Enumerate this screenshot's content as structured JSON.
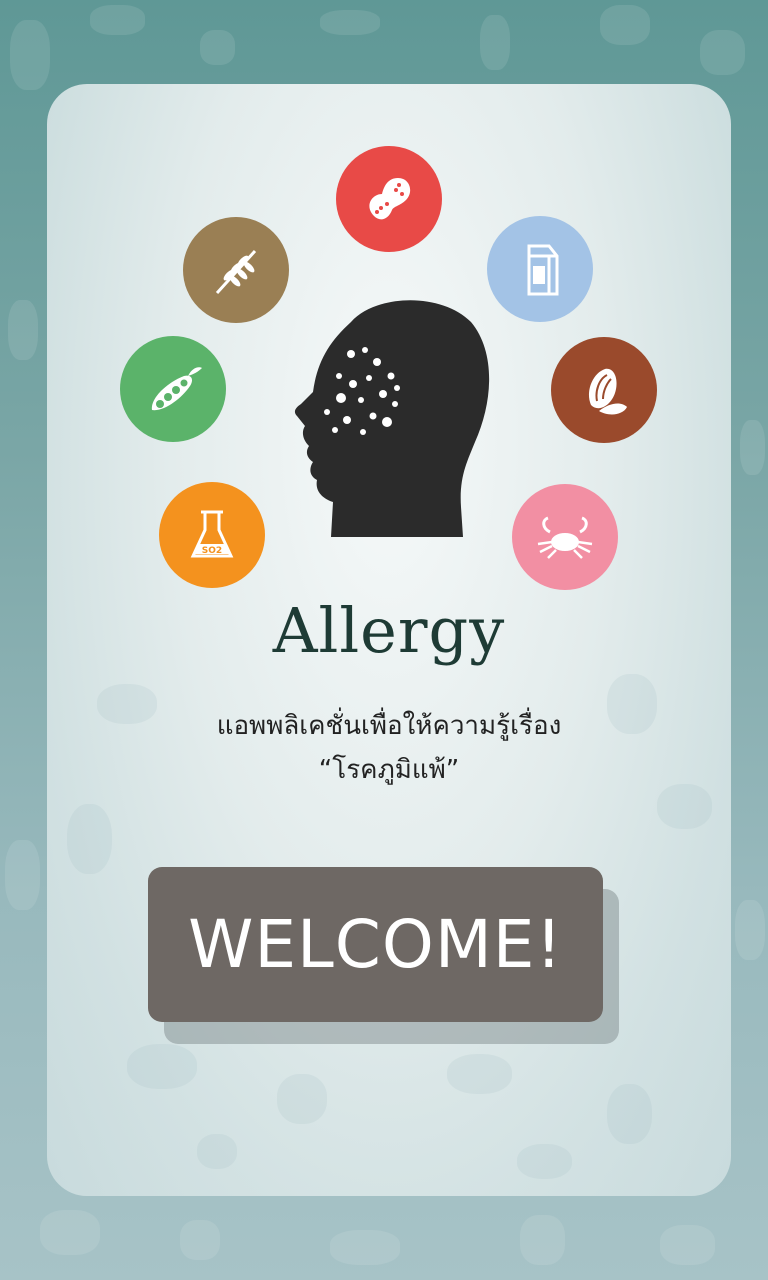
{
  "app": {
    "title": "Allergy",
    "subtitle_line1": "แอพพลิเคชั่นเพื่อให้ความรู้เรื่อง",
    "subtitle_line2": "“โรคภูมิแพ้”"
  },
  "welcome_button": {
    "label": "WELCOME!"
  },
  "allergens": [
    {
      "icon": "peanut-icon",
      "color": "#e84a47"
    },
    {
      "icon": "milk-carton-icon",
      "color": "#a3c3e6"
    },
    {
      "icon": "sunflower-seed-icon",
      "color": "#9a4a2c"
    },
    {
      "icon": "crab-icon",
      "color": "#f28fa3"
    },
    {
      "icon": "flask-so2-icon",
      "color": "#f4921e"
    },
    {
      "icon": "soybean-icon",
      "color": "#5bb36a"
    },
    {
      "icon": "wheat-icon",
      "color": "#9a7f54"
    }
  ],
  "icon_texts": {
    "so2": "SO2"
  },
  "colors": {
    "button": "#6e6864",
    "title": "#1e3b35",
    "head": "#2b2b2b"
  }
}
